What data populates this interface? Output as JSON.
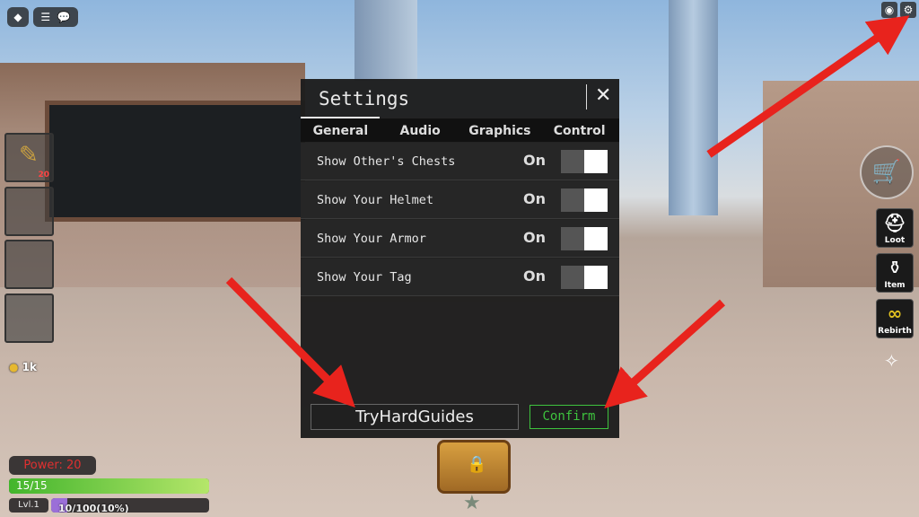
{
  "topbar": {
    "roblox_icon": "roblox-logo-icon",
    "menu_icon": "hamburger-icon",
    "chat_icon": "chat-icon",
    "camera_icon": "camera-icon",
    "settings_icon": "gear-icon"
  },
  "inventory": {
    "slots": [
      {
        "count": "20",
        "icon": "torch-icon"
      },
      {
        "count": ""
      },
      {
        "count": ""
      },
      {
        "count": ""
      }
    ]
  },
  "gold": {
    "value": "1k",
    "icon": "coin-icon"
  },
  "stats": {
    "power": "Power: 20",
    "health": "15/15",
    "health_fraction": 1.0,
    "level": "Lvl.1",
    "xp": "10/100(10%)",
    "xp_fraction": 0.1
  },
  "settings": {
    "title": "Settings",
    "close_icon": "close-icon",
    "tabs": [
      {
        "label": "General",
        "active": true
      },
      {
        "label": "Audio"
      },
      {
        "label": "Graphics"
      },
      {
        "label": "Control"
      }
    ],
    "options": [
      {
        "label": "Show Other's Chests",
        "value": "On"
      },
      {
        "label": "Show Your Helmet",
        "value": "On"
      },
      {
        "label": "Show Your Armor",
        "value": "On"
      },
      {
        "label": "Show Your Tag",
        "value": "On"
      }
    ],
    "name_input": "TryHardGuides",
    "confirm": "Confirm"
  },
  "right_menu": {
    "shop_icon": "shopping-cart-icon",
    "items": [
      {
        "label": "Loot",
        "icon": "helmet-icon"
      },
      {
        "label": "Item",
        "icon": "potion-icon"
      },
      {
        "label": "Rebirth",
        "icon": "infinity-icon"
      }
    ],
    "compass_icon": "compass-icon"
  },
  "colors": {
    "power_text": "#e03030",
    "health": "#7ad84a",
    "xp": "#9b6fd8",
    "confirm": "#3ec23e",
    "arrow": "#e8231d"
  }
}
